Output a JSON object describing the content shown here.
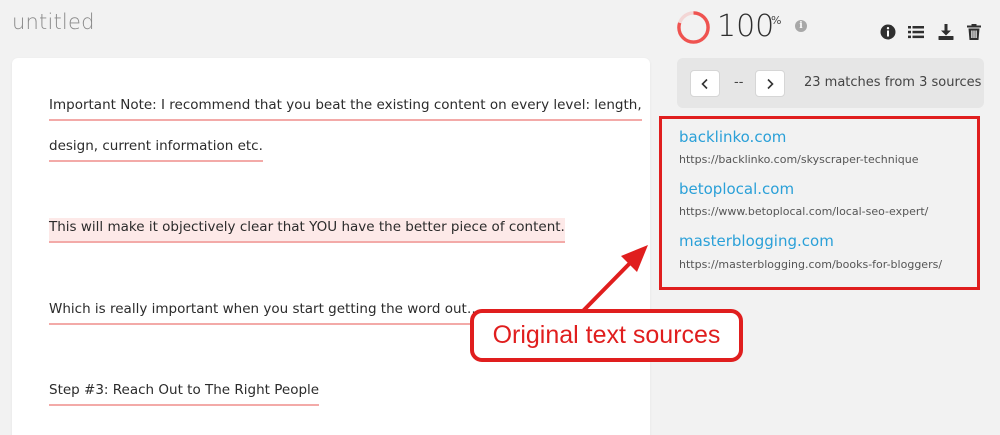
{
  "document": {
    "title": "untitled",
    "paragraphs": [
      {
        "lines": [
          "Important Note: I recommend that you beat the existing content on every level: length,",
          "design, current information etc."
        ]
      },
      {
        "lines": [
          "This will make it objectively clear that YOU have the better piece of content."
        ]
      },
      {
        "lines": [
          "Which is really important when you start getting the word out…"
        ]
      },
      {
        "lines": [
          "Step #3: Reach Out to The Right People"
        ]
      }
    ]
  },
  "score": {
    "value": "100",
    "unit": "%",
    "progress": 1.0,
    "ring_color": "#ef5350",
    "info_icon": "info-circle-icon"
  },
  "toolbar": {
    "icons": [
      "info-icon",
      "list-icon",
      "download-icon",
      "trash-icon"
    ]
  },
  "pager": {
    "position": "--",
    "match_summary": "23 matches from 3 sources"
  },
  "sources": [
    {
      "name": "backlinko.com",
      "url": "https://backlinko.com/skyscraper-technique"
    },
    {
      "name": "betoplocal.com",
      "url": "https://www.betoplocal.com/local-seo-expert/"
    },
    {
      "name": "masterblogging.com",
      "url": "https://masterblogging.com/books-for-bloggers/"
    }
  ],
  "annotation": {
    "label": "Original text sources",
    "color": "#e01e1e"
  },
  "colors": {
    "link": "#2aa0d8",
    "underline": "#f3aaa8",
    "highlight_bg": "#fde9e8"
  }
}
